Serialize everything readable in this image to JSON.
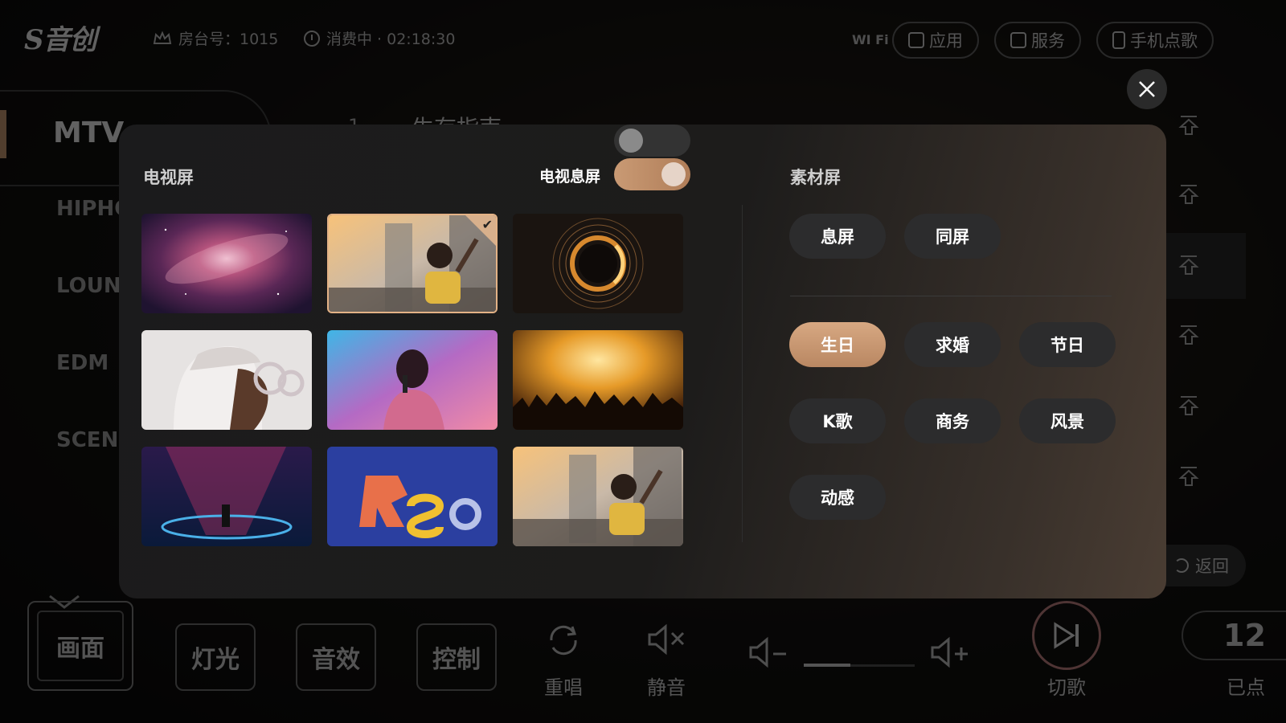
{
  "topbar": {
    "logo": "S音创",
    "room": "房台号：1015",
    "timer": "消费中 · 02:18:30",
    "wifi": "WI Fi",
    "apps_label": "应用",
    "services_label": "服务",
    "phone_order_label": "手机点歌"
  },
  "sidebar": {
    "active": "MTV",
    "items": [
      "HIPHO",
      "LOUN",
      "EDM",
      "SCEN"
    ]
  },
  "playlist": {
    "number": "1",
    "title": "生存指南"
  },
  "right_panel": {
    "return_label": "返回"
  },
  "bottom": {
    "screen_label": "画面",
    "light_label": "灯光",
    "effect_label": "音效",
    "control_label": "控制",
    "replay_label": "重唱",
    "mute_label": "静音",
    "skip_label": "切歌",
    "ordered_count": "12",
    "ordered_label": "已点",
    "volume_fraction": 0.42
  },
  "modal": {
    "tv_section_label": "电视屏",
    "tv_off_toggle_label": "电视息屏",
    "tv_off_toggle_on": true,
    "material_section_label": "素材屏",
    "screen_mode_chips": [
      "息屏",
      "同屏"
    ],
    "category_chips": [
      "生日",
      "求婚",
      "节日",
      "K歌",
      "商务",
      "风景",
      "动感"
    ],
    "active_category": "生日",
    "thumbnails": [
      {
        "name": "galaxy",
        "selected": false
      },
      {
        "name": "concert-fan-sunset",
        "selected": true
      },
      {
        "name": "golden-ring",
        "selected": false
      },
      {
        "name": "3d-character-glasses",
        "selected": false
      },
      {
        "name": "singer-microphone",
        "selected": false
      },
      {
        "name": "concert-crowd-fire",
        "selected": false
      },
      {
        "name": "stage-neon",
        "selected": false
      },
      {
        "name": "3d-letters-rsa",
        "selected": false
      },
      {
        "name": "concert-fan-sunset-2",
        "selected": false
      }
    ],
    "check_mark": "✔"
  },
  "colors": {
    "accent": "#d6a47a",
    "chip_bg": "#2c2c2d"
  }
}
